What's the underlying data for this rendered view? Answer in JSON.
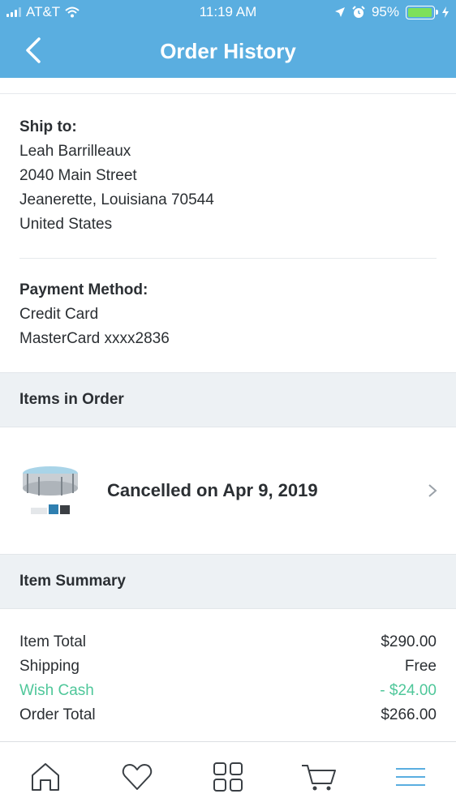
{
  "status_bar": {
    "carrier": "AT&T",
    "time": "11:19 AM",
    "battery": "95%",
    "battery_level": 0.95
  },
  "nav": {
    "title": "Order History"
  },
  "ship_to": {
    "label": "Ship to:",
    "name": "Leah Barrilleaux",
    "street": "2040 Main Street",
    "city_state_zip": "Jeanerette, Louisiana 70544",
    "country": "United States"
  },
  "payment": {
    "label": "Payment Method:",
    "method": "Credit Card",
    "card": "MasterCard xxxx2836"
  },
  "items_section": {
    "title": "Items in Order",
    "items": [
      {
        "status": "Cancelled on Apr 9, 2019",
        "thumbnail": "above-ground-pool-image"
      }
    ]
  },
  "summary": {
    "title": "Item Summary",
    "rows": [
      {
        "label": "Item Total",
        "value": "$290.00"
      },
      {
        "label": "Shipping",
        "value": "Free"
      },
      {
        "label": "Wish Cash",
        "value": "- $24.00"
      },
      {
        "label": "Order Total",
        "value": "$266.00"
      }
    ]
  },
  "tab_bar": {
    "tabs": [
      "home-icon",
      "heart-icon",
      "grid-icon",
      "cart-icon",
      "menu-icon"
    ],
    "active_color": "#5aaee0",
    "inactive_color": "#3a3f44"
  },
  "colors": {
    "header": "#5aaee0",
    "wish_cash": "#4fc79a"
  }
}
